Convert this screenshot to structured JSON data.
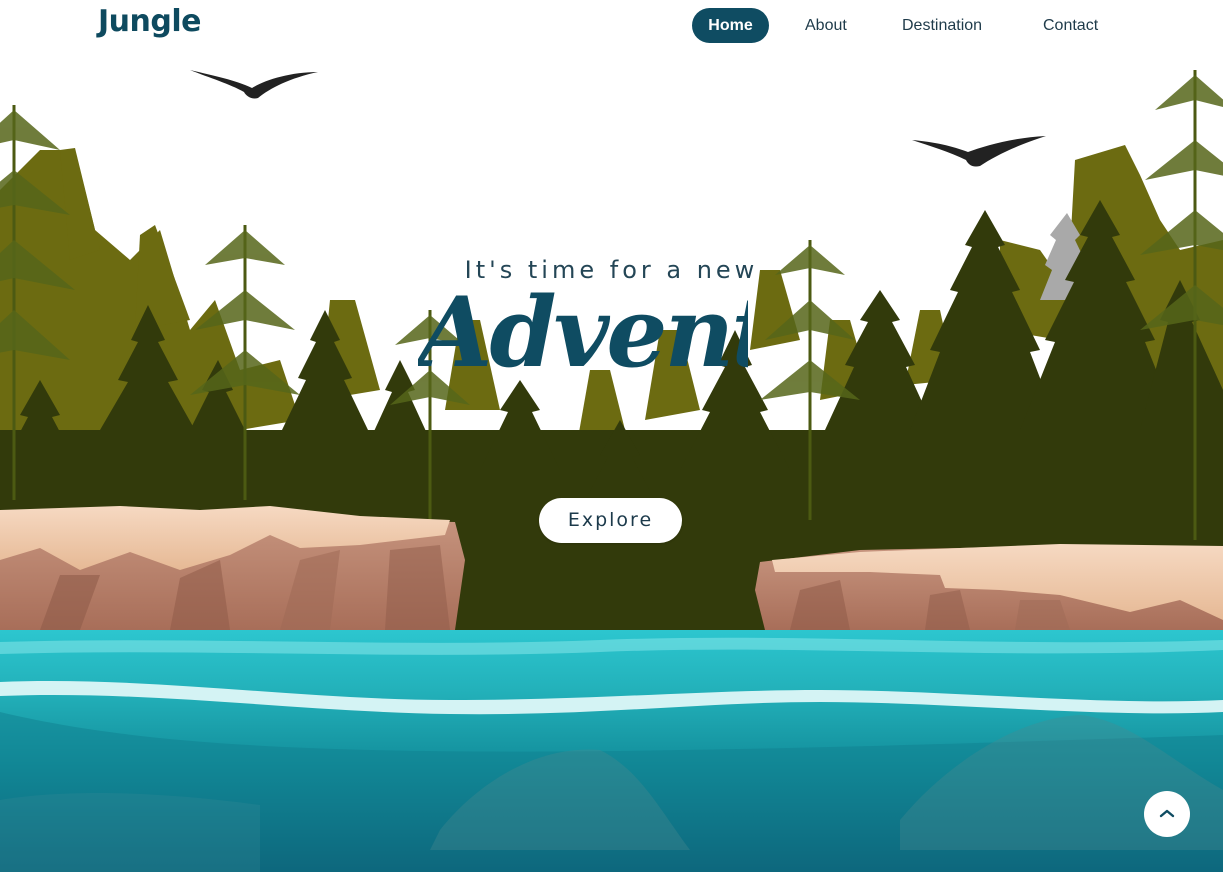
{
  "brand": {
    "logo": "Jungle"
  },
  "nav": {
    "items": [
      {
        "label": "Home",
        "active": true
      },
      {
        "label": "About",
        "active": false
      },
      {
        "label": "Destination",
        "active": false
      },
      {
        "label": "Contact",
        "active": false
      }
    ]
  },
  "hero": {
    "subtitle": "It's time for a new",
    "headline": "Adventure",
    "cta_label": "Explore"
  },
  "scroll_top": {
    "icon": "chevron-up-icon"
  },
  "colors": {
    "brand": "#0f4c62",
    "forest_light": "#6b6a12",
    "forest_dark": "#2f3a0c",
    "rock": "#c49078",
    "water": "#1aa6b0"
  }
}
